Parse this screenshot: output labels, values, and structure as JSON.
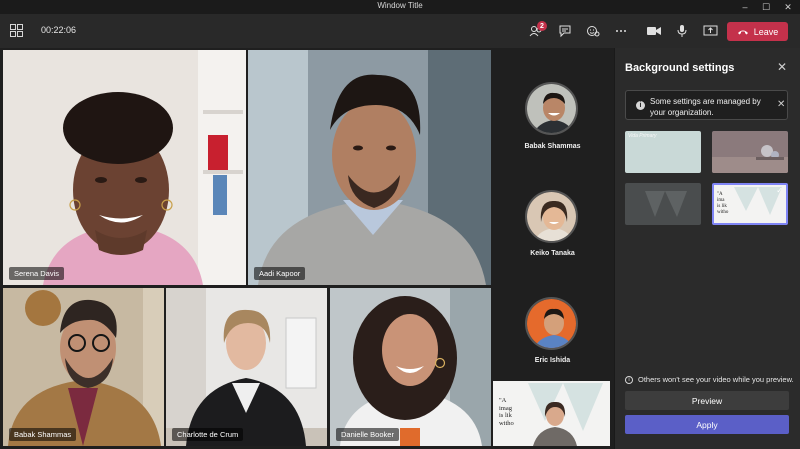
{
  "window": {
    "title": "Window Title"
  },
  "toolbar": {
    "timer": "00:22:06",
    "participants_badge": "2",
    "leave_label": "Leave"
  },
  "tiles": [
    {
      "name": "Serena Davis"
    },
    {
      "name": "Aadi Kapoor"
    },
    {
      "name": "Babak Shammas"
    },
    {
      "name": "Charlotte de Crum"
    },
    {
      "name": "Danielle Booker"
    }
  ],
  "roster": [
    {
      "name": "Babak Shammas"
    },
    {
      "name": "Keiko Tanaka"
    },
    {
      "name": "Eric Ishida"
    }
  ],
  "self_preview": {
    "text_line1": "\"A",
    "text_line2": "imag",
    "text_line3": "is lik",
    "text_line4": "witho"
  },
  "panel": {
    "title": "Background settings",
    "notice": "Some settings are managed by your organization.",
    "option1_brand": "Vida Primary",
    "option4_line1": "\"A",
    "option4_line2": "ima",
    "option4_line3": "is lik",
    "option4_line4": "witho",
    "preview_note": "Others won't see your video while you preview.",
    "preview_label": "Preview",
    "apply_label": "Apply"
  },
  "colors": {
    "leave": "#c4314b",
    "apply": "#5b5fc7",
    "selected_border": "#7f85f5"
  }
}
